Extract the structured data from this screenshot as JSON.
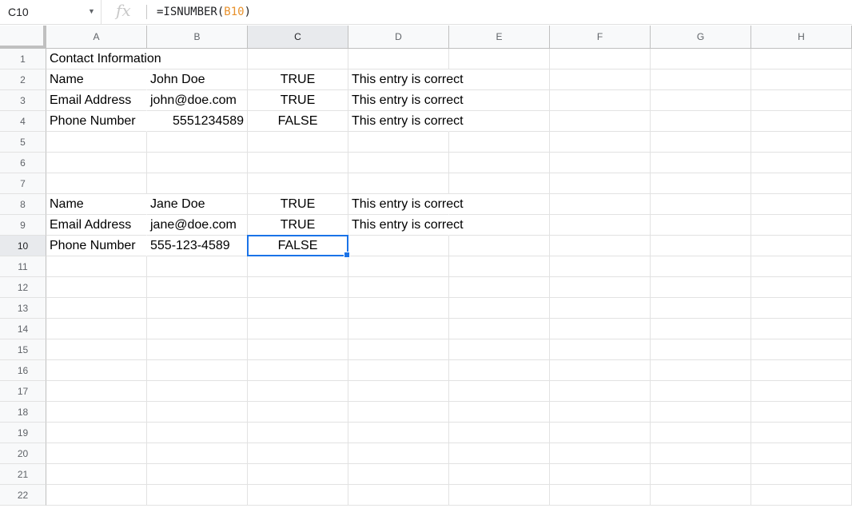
{
  "name_box": {
    "value": "C10"
  },
  "formula_bar": {
    "fx_label": "fx",
    "formula_prefix": "=ISNUMBER(",
    "formula_ref": "B10",
    "formula_suffix": ")",
    "ref_color": "#e8912c"
  },
  "columns": [
    "A",
    "B",
    "C",
    "D",
    "E",
    "F",
    "G",
    "H"
  ],
  "rows": [
    "1",
    "2",
    "3",
    "4",
    "5",
    "6",
    "7",
    "8",
    "9",
    "10",
    "11",
    "12",
    "13",
    "14",
    "15",
    "16",
    "17",
    "18",
    "19",
    "20",
    "21",
    "22"
  ],
  "selected": {
    "column": "C",
    "row": "10"
  },
  "cells": {
    "A1": "Contact Information",
    "A2": "Name",
    "B2": "John Doe",
    "C2": "TRUE",
    "D2": "This entry is correct",
    "A3": "Email Address",
    "B3": "john@doe.com",
    "C3": "TRUE",
    "D3": "This entry is correct",
    "A4": "Phone Number",
    "B4": "5551234589",
    "C4": "FALSE",
    "D4": "This entry is correct",
    "A8": "Name",
    "B8": "Jane Doe",
    "C8": "TRUE",
    "D8": "This entry is correct",
    "A9": "Email Address",
    "B9": "jane@doe.com",
    "C9": "TRUE",
    "D9": "This entry is correct",
    "A10": "Phone Number",
    "B10": "555-123-4589",
    "C10": "FALSE"
  },
  "colors": {
    "selection": "#1a73e8",
    "header_bg": "#f8f9fa",
    "selected_header_bg": "#e8eaed"
  }
}
